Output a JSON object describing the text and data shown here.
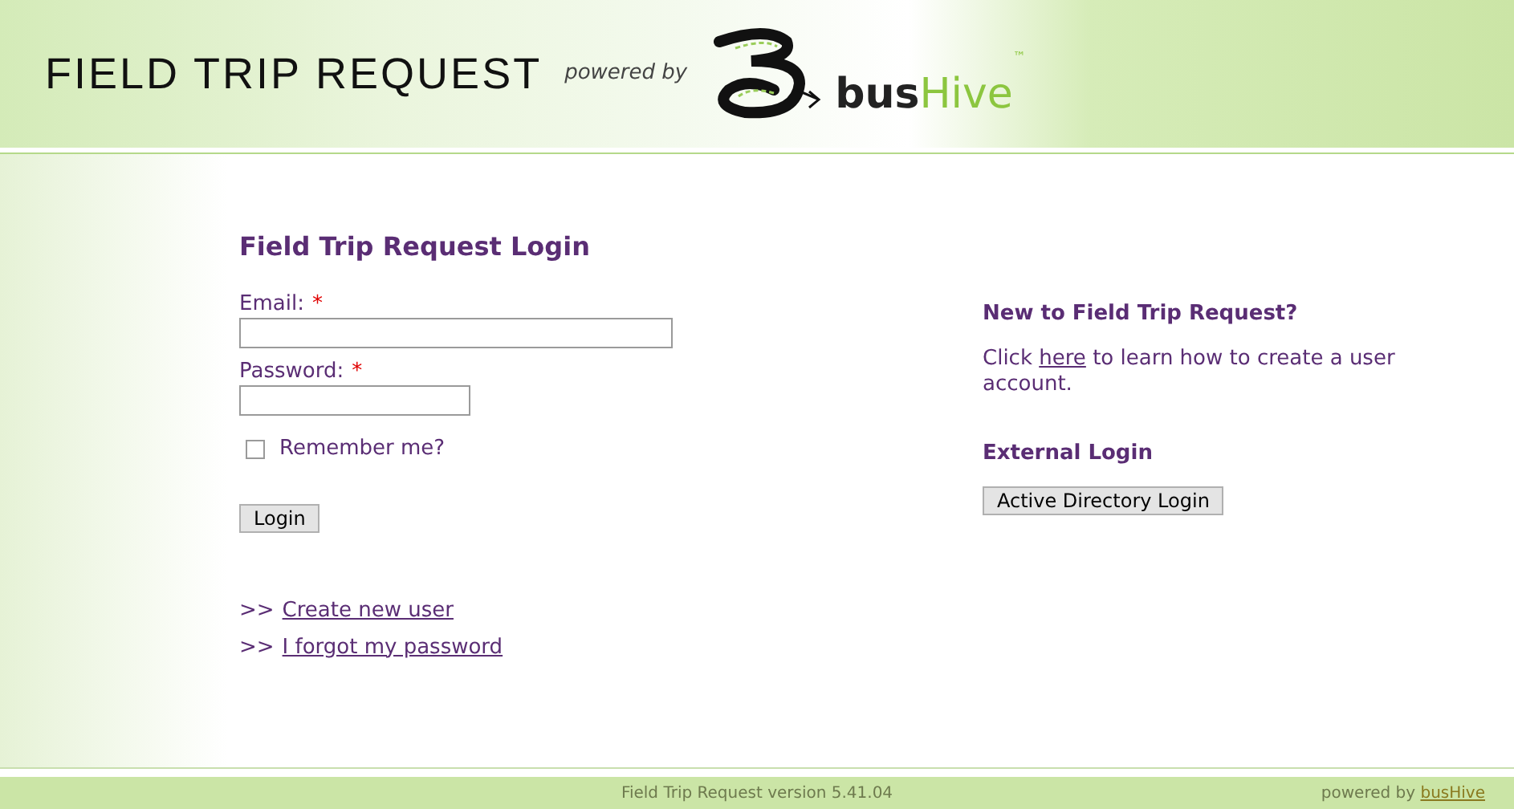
{
  "header": {
    "title": "FIELD TRIP REQUEST",
    "powered_by": "powered by",
    "brand_first": "bus",
    "brand_second": "Hive",
    "trademark": "™"
  },
  "login": {
    "title": "Field Trip Request Login",
    "fields": [
      {
        "label": "Email:",
        "required_mark": "*",
        "kind": "wide"
      },
      {
        "label": "Password:",
        "required_mark": "*",
        "kind": "narrow"
      }
    ],
    "remember": {
      "label": "Remember me?",
      "checked": false
    },
    "button": "Login",
    "links": [
      {
        "prefix": ">>",
        "label": "Create new user"
      },
      {
        "prefix": ">>",
        "label": "I forgot my password"
      }
    ]
  },
  "side": {
    "new_heading": "New to Field Trip Request?",
    "text_before": "Click",
    "link": "here",
    "text_after": "to learn how to create a user account.",
    "external_heading": "External Login",
    "external_button": "Active Directory Login"
  },
  "footer": {
    "version": "Field Trip Request version 5.41.04",
    "powered_by": "powered by",
    "link": "busHive"
  }
}
